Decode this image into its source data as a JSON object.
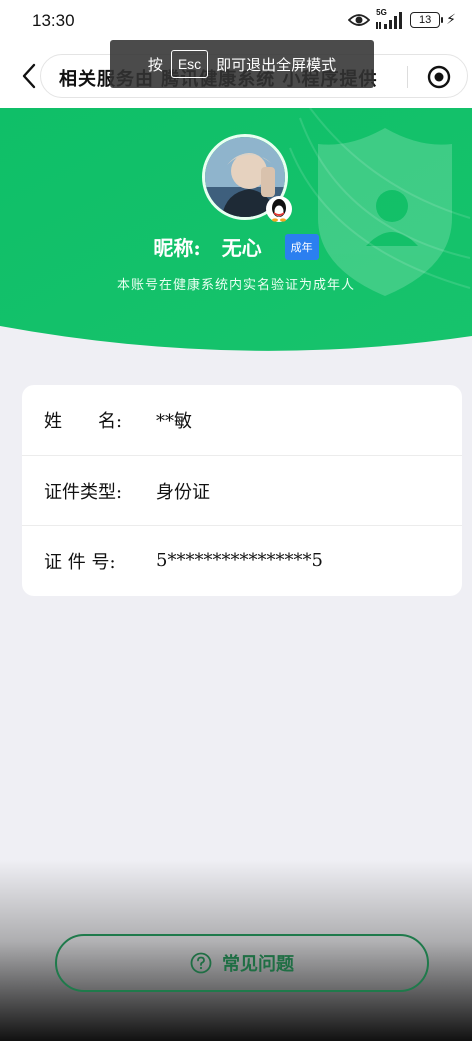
{
  "status_bar": {
    "time": "13:30",
    "network_label": "5G",
    "battery_level": "13",
    "icons": [
      "eye-icon",
      "signal-icon",
      "battery-icon",
      "charging-bolt-icon"
    ]
  },
  "nav": {
    "title": "相关服务由    腾讯健康系统    小程序提供",
    "back_icon": "chevron-left-icon",
    "record_icon": "record-icon"
  },
  "toast": {
    "prefix": "按",
    "key": "Esc",
    "suffix": "即可退出全屏模式"
  },
  "profile": {
    "nickname_label": "昵称:",
    "nickname_value": "无心",
    "adult_badge": "成年",
    "verify_note": "本账号在健康系统内实名验证为成年人",
    "colors": {
      "green_top": "#10c86a",
      "green_bottom": "#16b95f",
      "badge_blue": "#2b7ff0"
    }
  },
  "info": {
    "rows": [
      {
        "label": "姓　　名:",
        "value": "**敏"
      },
      {
        "label": "证件类型:",
        "value": "身份证"
      },
      {
        "label": "证 件 号:",
        "value": "5****************5"
      }
    ]
  },
  "faq": {
    "label": "常见问题",
    "icon": "question-circle-icon"
  }
}
